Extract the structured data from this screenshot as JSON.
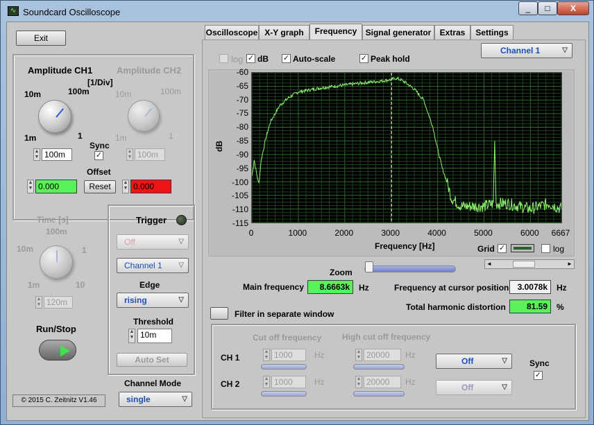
{
  "window": {
    "title": "Soundcard Oscilloscope",
    "min": "_",
    "max": "□",
    "close": "X"
  },
  "left": {
    "exit": "Exit",
    "amp_ch1": "Amplitude CH1",
    "amp_ch2": "Amplitude CH2",
    "div": "[1/Div]",
    "knob1_labels": [
      "10m",
      "100m",
      "1m",
      "1"
    ],
    "knob2_labels": [
      "10m",
      "100m",
      "1m",
      "1"
    ],
    "ch1_value": "100m",
    "ch2_value": "100m",
    "sync": "Sync",
    "offset": "Offset",
    "offset_ch1": "0.000",
    "offset_ch2": "0.000",
    "reset": "Reset",
    "time": "Time [s]",
    "time_labels": [
      "100m",
      "10m",
      "1",
      "1m",
      "10"
    ],
    "time_value": "120m",
    "run_stop": "Run/Stop",
    "copyright": "© 2015  C. Zeitnitz V1.46"
  },
  "trigger": {
    "title": "Trigger",
    "mode": "Off",
    "channel": "Channel 1",
    "edge_label": "Edge",
    "edge": "rising",
    "threshold_label": "Threshold",
    "threshold": "10m",
    "autoset": "Auto Set",
    "channel_mode_label": "Channel Mode",
    "channel_mode": "single"
  },
  "tabs": [
    "Oscilloscope",
    "X-Y graph",
    "Frequency",
    "Signal generator",
    "Extras",
    "Settings"
  ],
  "freq": {
    "log": "log",
    "db": "dB",
    "autoscale": "Auto-scale",
    "peakhold": "Peak hold",
    "channel": "Channel 1",
    "ylabel": "dB",
    "xlabel": "Frequency [Hz]",
    "grid": "Grid",
    "log2": "log",
    "zoom": "Zoom",
    "main_freq_label": "Main frequency",
    "main_freq": "8.6663k",
    "hz1": "Hz",
    "cursor_label": "Frequency at cursor position",
    "cursor_val": "3.0078k",
    "hz2": "Hz",
    "thd_label": "Total harmonic distortion",
    "thd": "81.59",
    "pct": "%",
    "filter_sep": "Filter in separate window",
    "cutoff": "Cut off frequency",
    "highcut": "High cut off frequency",
    "ch1": "CH 1",
    "ch2": "CH 2",
    "cut1": "1000",
    "cut2": "1000",
    "high1": "20000",
    "high2": "20000",
    "hz": "Hz",
    "filter1": "Off",
    "filter2": "Off",
    "sync": "Sync"
  },
  "chart_data": {
    "type": "line",
    "xlabel": "Frequency [Hz]",
    "ylabel": "dB",
    "xlim": [
      0,
      6667
    ],
    "ylim": [
      -115,
      -60
    ],
    "x_ticks": [
      "0",
      "1000",
      "2000",
      "3000",
      "4000",
      "5000",
      "6000",
      "6667"
    ],
    "y_ticks": [
      "-60",
      "-65",
      "-70",
      "-75",
      "-80",
      "-85",
      "-90",
      "-95",
      "-100",
      "-105",
      "-110",
      "-115"
    ],
    "cursor_x": 3007.8,
    "series": [
      {
        "x": [
          0,
          50,
          100,
          150,
          200,
          300,
          400,
          600,
          800,
          1000,
          1500,
          2000,
          2500,
          2800,
          3000,
          3100,
          3200,
          3300,
          3500,
          3700,
          3900,
          4000,
          4100,
          4200,
          4300,
          4500,
          5000,
          5200,
          5230,
          5260,
          5500,
          6000,
          6400,
          6667
        ],
        "y": [
          -98,
          -92,
          -97,
          -101,
          -92,
          -84,
          -78,
          -72,
          -69,
          -67,
          -65.5,
          -64.5,
          -63.5,
          -63,
          -62.5,
          -62,
          -62.5,
          -63.5,
          -66,
          -70,
          -80,
          -88,
          -95,
          -100,
          -106,
          -109,
          -109,
          -108,
          -85,
          -108,
          -108,
          -110,
          -108,
          -110
        ]
      }
    ]
  }
}
